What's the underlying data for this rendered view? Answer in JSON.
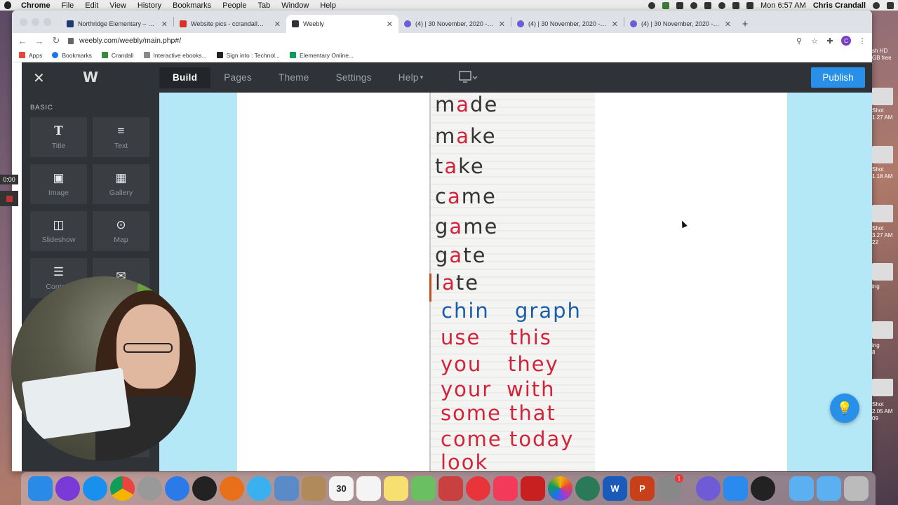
{
  "menubar": {
    "app": "Chrome",
    "items": [
      "File",
      "Edit",
      "View",
      "History",
      "Bookmarks",
      "People",
      "Tab",
      "Window",
      "Help"
    ],
    "clock": "Mon 6:57 AM",
    "user": "Chris Crandall"
  },
  "browser": {
    "tabs": [
      {
        "title": "Northridge Elementary – Home",
        "color": "#1e3a6e",
        "active": false
      },
      {
        "title": "Website pics - ccrandall@alpin",
        "color": "#d93025",
        "active": false
      },
      {
        "title": "Weebly",
        "color": "#2f3236",
        "active": true
      },
      {
        "title": "(4) | 30 November, 2020 - Hel",
        "color": "#6f5bd6",
        "active": false
      },
      {
        "title": "(4) | 30 November, 2020 - way",
        "color": "#6f5bd6",
        "active": false
      },
      {
        "title": "(4) | 30 November, 2020 - Rea",
        "color": "#6f5bd6",
        "active": false
      }
    ],
    "url": "weebly.com/weebly/main.php#/",
    "profile_initial": "C",
    "bookmarks": [
      {
        "label": "Apps",
        "color": "#e8453c"
      },
      {
        "label": "Bookmarks",
        "color": "#1a73e8"
      },
      {
        "label": "Crandall",
        "color": "#3a8a3a"
      },
      {
        "label": "Interactive ebooks...",
        "color": "#888"
      },
      {
        "label": "Sign into : Technol...",
        "color": "#222"
      },
      {
        "label": "Elementary Online...",
        "color": "#0f9d58"
      }
    ]
  },
  "weebly": {
    "nav": [
      "Build",
      "Pages",
      "Theme",
      "Settings",
      "Help"
    ],
    "active_nav": "Build",
    "publish": "Publish",
    "panel_section": "BASIC",
    "elements": [
      {
        "label": "Title",
        "icon": "T"
      },
      {
        "label": "Text",
        "icon": "≡"
      },
      {
        "label": "Image",
        "icon": "▣"
      },
      {
        "label": "Gallery",
        "icon": "▦"
      },
      {
        "label": "Slideshow",
        "icon": "◫"
      },
      {
        "label": "Map",
        "icon": "⊙"
      },
      {
        "label": "Contact",
        "icon": "☰"
      },
      {
        "label": "",
        "icon": "✉"
      }
    ]
  },
  "chart_words": {
    "made": "made",
    "make": "make",
    "take": "take",
    "came": "came",
    "game": "game",
    "gate": "gate",
    "late": "late",
    "chin": "chin",
    "graph": "graph",
    "use": "use",
    "this": "this",
    "you": "you",
    "they": "they",
    "your": "your",
    "with": "with",
    "some": "some",
    "that": "that",
    "come": "come",
    "today": "today",
    "look": "look"
  },
  "recording": {
    "time": "0:00"
  },
  "desktop_labels": [
    "Shot",
    "1.27 AM",
    "Shot",
    "1.18 AM",
    "Shot",
    "3.27 AM",
    "22",
    "ing",
    "ing",
    "8",
    "Shot",
    "2.05 AM",
    "09",
    "sh HD",
    "GB free"
  ],
  "dock": [
    {
      "name": "finder",
      "color": "#2a8ae8"
    },
    {
      "name": "siri",
      "color": "#7a3ad8"
    },
    {
      "name": "safari",
      "color": "#1a90ee"
    },
    {
      "name": "chrome",
      "color": "#e8e8e8"
    },
    {
      "name": "launchpad",
      "color": "#999"
    },
    {
      "name": "app-store",
      "color": "#2a7ae8"
    },
    {
      "name": "dashboard",
      "color": "#222"
    },
    {
      "name": "firefox",
      "color": "#e8701a"
    },
    {
      "name": "messages",
      "color": "#3ab0ee"
    },
    {
      "name": "preview",
      "color": "#5a8ac8"
    },
    {
      "name": "contacts",
      "color": "#b08a5a"
    },
    {
      "name": "calendar",
      "color": "#f4f4f4",
      "text": "30"
    },
    {
      "name": "reminders",
      "color": "#f4f4f4"
    },
    {
      "name": "notes",
      "color": "#f8e070"
    },
    {
      "name": "maps",
      "color": "#6ac060"
    },
    {
      "name": "photo-booth",
      "color": "#c84040"
    },
    {
      "name": "news",
      "color": "#e8343a"
    },
    {
      "name": "music",
      "color": "#f43a5a"
    },
    {
      "name": "photo-app",
      "color": "#c82020"
    },
    {
      "name": "photos",
      "color": "#f4f4f4"
    },
    {
      "name": "time-machine",
      "color": "#2a7a5a"
    },
    {
      "name": "word",
      "color": "#1a5ab8",
      "text": "W"
    },
    {
      "name": "powerpoint",
      "color": "#c8401a",
      "text": "P"
    },
    {
      "name": "system-prefs",
      "color": "#888",
      "badge": "1"
    },
    {
      "name": "screencastify",
      "color": "#6f5bd6"
    },
    {
      "name": "zoom",
      "color": "#2a8aee"
    },
    {
      "name": "quicktime",
      "color": "#222"
    },
    {
      "name": "applications",
      "color": "#5ab0f0"
    },
    {
      "name": "documents",
      "color": "#5ab0f0"
    },
    {
      "name": "trash",
      "color": "#bbb"
    }
  ]
}
